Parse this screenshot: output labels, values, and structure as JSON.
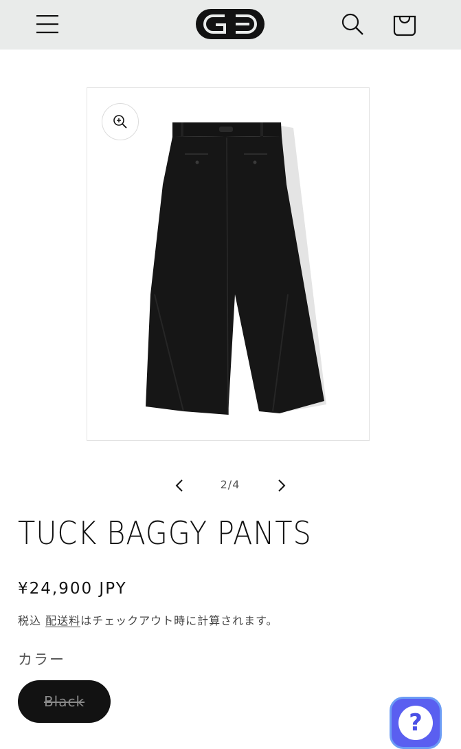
{
  "header": {
    "menu_icon": "hamburger-menu-icon",
    "logo_icon": "brand-logo",
    "search_icon": "search-icon",
    "cart_icon": "cart-icon",
    "background": "#e9ebea"
  },
  "gallery": {
    "zoom_icon": "zoom-in-icon",
    "counter": "2/4",
    "prev_icon": "chevron-left-icon",
    "next_icon": "chevron-right-icon"
  },
  "product": {
    "title": "TUCK BAGGY PANTS",
    "price": "¥24,900 JPY",
    "tax_prefix": "税込",
    "shipping_link": "配送料",
    "tax_suffix": "はチェックアウト時に計算されます。",
    "color_label": "カラー",
    "variant": "Black"
  },
  "help": {
    "icon": "question-icon",
    "glyph": "?",
    "background": "#5a5ff0"
  }
}
